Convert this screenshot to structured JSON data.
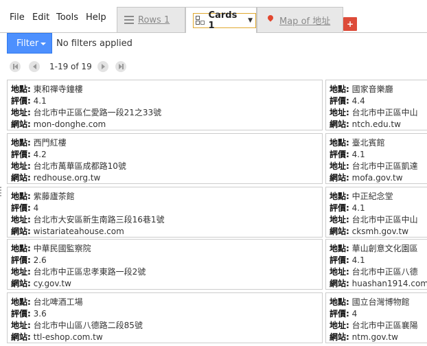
{
  "menu": [
    "File",
    "Edit",
    "Tools",
    "Help"
  ],
  "tabs": [
    {
      "label": "Rows 1",
      "icon": "rows-icon"
    },
    {
      "label": "Cards 1",
      "icon": "cards-icon",
      "active": true
    },
    {
      "label": "Map of 地址",
      "icon": "map-pin-icon"
    }
  ],
  "add_tab_label": "+",
  "filter": {
    "button_label": "Filter",
    "status": "No filters applied"
  },
  "pager": {
    "text": "1-19 of 19"
  },
  "field_labels": {
    "place": "地點:",
    "rating": "評價:",
    "address": "地址:",
    "website": "網站:"
  },
  "cards_left": [
    {
      "place": "東和禪寺鐘樓",
      "rating": "4.1",
      "address": "台北市中正區仁愛路一段21之33號",
      "website": "mon-donghe.com"
    },
    {
      "place": "西門紅樓",
      "rating": "4.2",
      "address": "台北市萬華區成都路10號",
      "website": "redhouse.org.tw"
    },
    {
      "place": "紫藤廬茶館",
      "rating": "4",
      "address": "台北市大安區新生南路三段16巷1號",
      "website": "wistariateahouse.com"
    },
    {
      "place": "中華民國監察院",
      "rating": "2.6",
      "address": "台北市中正區忠孝東路一段2號",
      "website": "cy.gov.tw"
    },
    {
      "place": "台北啤酒工場",
      "rating": "3.6",
      "address": "台北市中山區八德路二段85號",
      "website": "ttl-eshop.com.tw"
    }
  ],
  "cards_right": [
    {
      "place": "國家音樂廳",
      "rating": "4.4",
      "address": "台北市中正區中山",
      "website": "ntch.edu.tw"
    },
    {
      "place": "臺北賓館",
      "rating": "4.1",
      "address": "台北市中正區凱達",
      "website": "mofa.gov.tw"
    },
    {
      "place": "中正紀念堂",
      "rating": "4.1",
      "address": "台北市中正區中山",
      "website": "cksmh.gov.tw"
    },
    {
      "place": "華山創意文化園區",
      "rating": "4.1",
      "address": "台北市中正區八德",
      "website": "huashan1914.com"
    },
    {
      "place": "國立台灣博物館",
      "rating": "4",
      "address": "台北市中正區襄陽",
      "website": "ntm.gov.tw"
    }
  ],
  "colors": {
    "accent": "#4d90fe",
    "add_tab": "#dd4b39",
    "active_tab_border": "#e0a82e",
    "pin": "#e2472f"
  }
}
